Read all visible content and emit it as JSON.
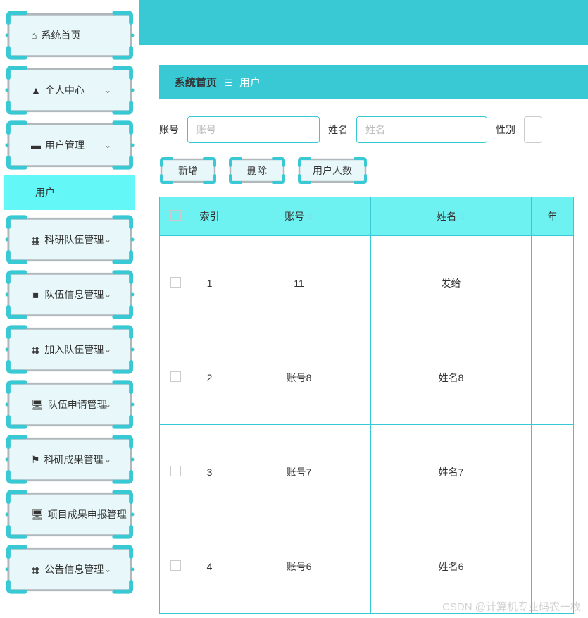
{
  "sidebar": {
    "items": [
      {
        "label": "系统首页",
        "icon": "home",
        "has_caret": false
      },
      {
        "label": "个人中心",
        "icon": "user",
        "has_caret": true
      },
      {
        "label": "用户管理",
        "icon": "chart",
        "has_caret": true
      },
      {
        "label": "科研队伍管理",
        "icon": "grid",
        "has_caret": true
      },
      {
        "label": "队伍信息管理",
        "icon": "box",
        "has_caret": true
      },
      {
        "label": "加入队伍管理",
        "icon": "grid",
        "has_caret": true
      },
      {
        "label": "队伍申请管理",
        "icon": "monitor",
        "has_caret": true
      },
      {
        "label": "科研成果管理",
        "icon": "flag",
        "has_caret": true
      },
      {
        "label": "项目成果申报管理",
        "icon": "monitor",
        "has_caret": true
      },
      {
        "label": "公告信息管理",
        "icon": "grid",
        "has_caret": true
      }
    ],
    "submenu_label": "用户"
  },
  "breadcrumb": {
    "home": "系统首页",
    "current": "用户",
    "sep": "☰"
  },
  "filters": {
    "account_label": "账号",
    "account_placeholder": "账号",
    "name_label": "姓名",
    "name_placeholder": "姓名",
    "gender_label": "性别"
  },
  "actions": {
    "add": "新增",
    "del": "删除",
    "count": "用户人数"
  },
  "table": {
    "headers": {
      "index": "索引",
      "account": "账号",
      "name": "姓名",
      "year": "年"
    },
    "rows": [
      {
        "index": "1",
        "account": "11",
        "name": "发给"
      },
      {
        "index": "2",
        "account": "账号8",
        "name": "姓名8"
      },
      {
        "index": "3",
        "account": "账号7",
        "name": "姓名7"
      },
      {
        "index": "4",
        "account": "账号6",
        "name": "姓名6"
      }
    ]
  },
  "watermark": "CSDN @计算机专业码农一枚"
}
